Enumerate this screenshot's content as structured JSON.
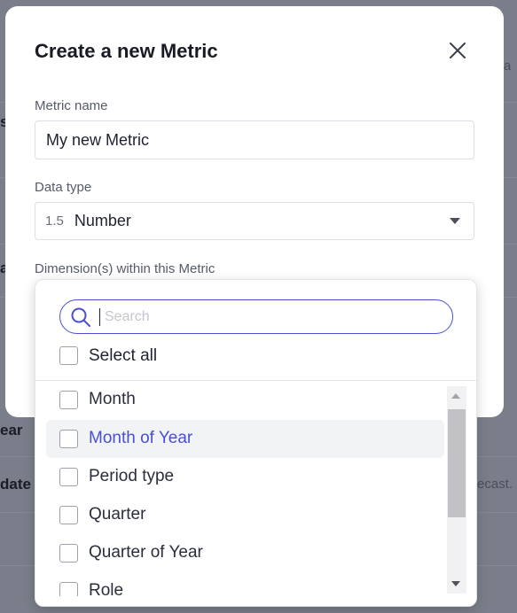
{
  "background": {
    "fragments": [
      "a",
      "s",
      "a",
      "ear",
      "date",
      "ecast."
    ]
  },
  "modal": {
    "title": "Create a new Metric",
    "close_icon": "close-icon",
    "metric_name": {
      "label": "Metric name",
      "value": "My new Metric"
    },
    "data_type": {
      "label": "Data type",
      "prefix": "1.5",
      "value": "Number"
    },
    "dimensions": {
      "label": "Dimension(s) within this Metric"
    }
  },
  "dropdown": {
    "search_placeholder": "Search",
    "select_all_label": "Select all",
    "options": [
      {
        "label": "Month",
        "checked": false
      },
      {
        "label": "Month of Year",
        "checked": false
      },
      {
        "label": "Period type",
        "checked": false
      },
      {
        "label": "Quarter",
        "checked": false
      },
      {
        "label": "Quarter of Year",
        "checked": false
      },
      {
        "label": "Role",
        "checked": false
      }
    ]
  },
  "colors": {
    "accent": "#4a4fd1",
    "overlay": "#6f7380"
  }
}
